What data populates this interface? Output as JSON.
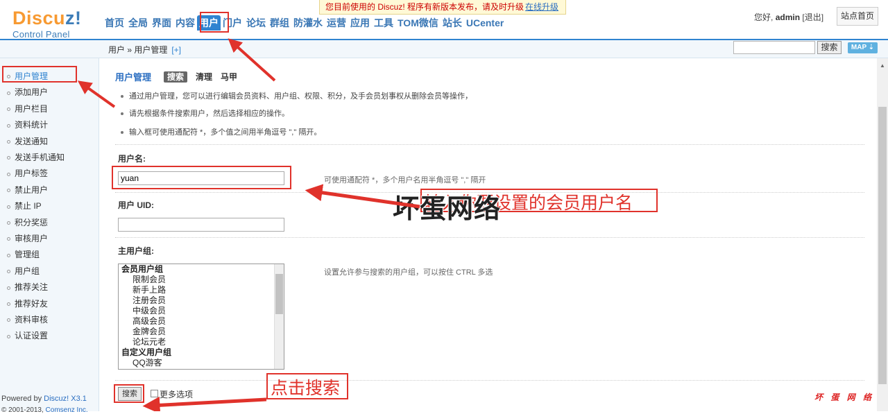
{
  "logo": {
    "brand_main": "Discu",
    "brand_z": "z!",
    "subtitle": "Control Panel"
  },
  "nav": [
    "首页",
    "全局",
    "界面",
    "内容",
    "用户",
    "门户",
    "论坛",
    "群组",
    "防灌水",
    "运营",
    "应用",
    "工具",
    "TOM微信",
    "站长",
    "UCenter"
  ],
  "nav_active": 4,
  "notice": {
    "message": "您目前使用的 Discuz! 程序有新版本发布，请及时升级",
    "link": "在线升级"
  },
  "user": {
    "greeting": "您好,",
    "name": "admin",
    "logout": "[退出]",
    "site_home": "站点首页"
  },
  "breadcrumb": {
    "path": "用户 » 用户管理",
    "add": "[+]"
  },
  "top_search": {
    "button": "搜索",
    "map": "MAP ⇣"
  },
  "sidebar": {
    "items": [
      "用户管理",
      "添加用户",
      "用户栏目",
      "资料统计",
      "发送通知",
      "发送手机通知",
      "用户标签",
      "禁止用户",
      "禁止 IP",
      "积分奖惩",
      "审核用户",
      "管理组",
      "用户组",
      "推荐关注",
      "推荐好友",
      "资料审核",
      "认证设置"
    ],
    "active": 0,
    "powered_prefix": "Powered by ",
    "powered_link": "Discuz! X3.1",
    "copyright_prefix": "© 2001-2013, ",
    "copyright_link": "Comsenz Inc."
  },
  "main": {
    "title": "用户管理",
    "tabs": [
      "搜索",
      "清理",
      "马甲"
    ],
    "active_tab": 0,
    "tips": [
      "通过用户管理，您可以进行编辑会员资料、用户组、权限、积分，及手会员划事权从删除会员等操作，",
      "请先根据条件搜索用户，然后选择相应的操作。",
      "输入框可使用通配符 *，多个值之间用半角逗号 \",\" 隔开。"
    ],
    "username_label": "用户名:",
    "username_value": "yuan",
    "username_hint": "可使用通配符 *，多个用户名用半角逗号 \",\" 隔开",
    "uid_label": "用户 UID:",
    "uid_value": "",
    "group_label": "主用户组:",
    "group_hint": "设置允许参与搜索的用户组，可以按住 CTRL 多选",
    "groups": [
      {
        "type": "group",
        "label": "会员用户组"
      },
      {
        "type": "option",
        "label": "限制会员"
      },
      {
        "type": "option",
        "label": "新手上路"
      },
      {
        "type": "option",
        "label": "注册会员"
      },
      {
        "type": "option",
        "label": "中级会员"
      },
      {
        "type": "option",
        "label": "高级会员"
      },
      {
        "type": "option",
        "label": "金牌会员"
      },
      {
        "type": "option",
        "label": "论坛元老"
      },
      {
        "type": "group",
        "label": "自定义用户组"
      },
      {
        "type": "option",
        "label": "QQ游客"
      }
    ],
    "search_button": "搜索",
    "more_options": "更多选项",
    "watermark_small": "坏 蛋 网 络"
  },
  "annotations": {
    "username_note": "输入你要设置的会员用户名",
    "click_search": "点击搜索",
    "watermark_big": "坏蛋网络",
    "color": "#e0322b"
  }
}
